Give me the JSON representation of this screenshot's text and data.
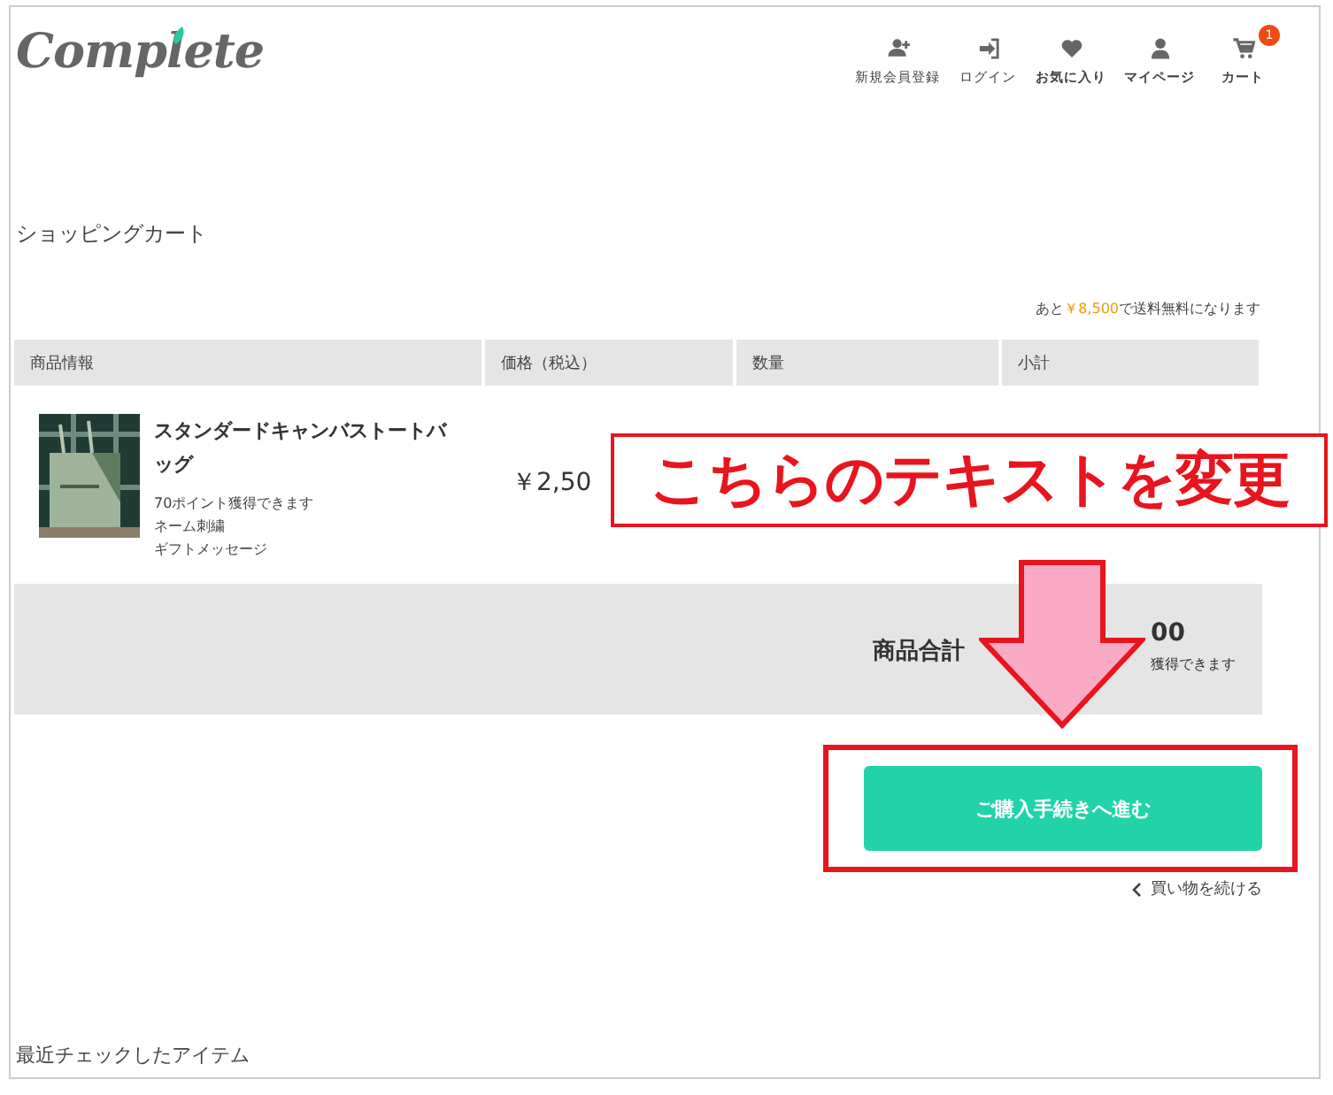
{
  "header": {
    "logo": "Complete",
    "nav": [
      {
        "kind": "user-plus",
        "label": "新規会員登録",
        "bold": false
      },
      {
        "kind": "login",
        "label": "ログイン",
        "bold": false
      },
      {
        "kind": "heart",
        "label": "お気に入り",
        "bold": true
      },
      {
        "kind": "user",
        "label": "マイページ",
        "bold": true
      },
      {
        "kind": "cart",
        "label": "カート",
        "bold": true,
        "badge": "1"
      }
    ]
  },
  "cart": {
    "title": "ショッピングカート",
    "notice": {
      "before": "あと",
      "amount": "￥8,500",
      "after": "で送料無料になります"
    },
    "columns": [
      "商品情報",
      "価格（税込）",
      "数量",
      "小計"
    ],
    "items": [
      {
        "name": "スタンダードキャンバストートバッグ",
        "points": "70ポイント獲得できます",
        "options": [
          "ネーム刺繍",
          "ギフトメッセージ"
        ],
        "price": "￥2,50"
      }
    ],
    "total": {
      "label": "商品合計",
      "amount": "00",
      "points": "獲得できます"
    },
    "checkout_button": "ご購入手続きへ進む",
    "continue_link": "買い物を続ける"
  },
  "recent": {
    "title": "最近チェックしたアイテム"
  },
  "annotation": {
    "callout": "こちらのテキストを変更"
  }
}
